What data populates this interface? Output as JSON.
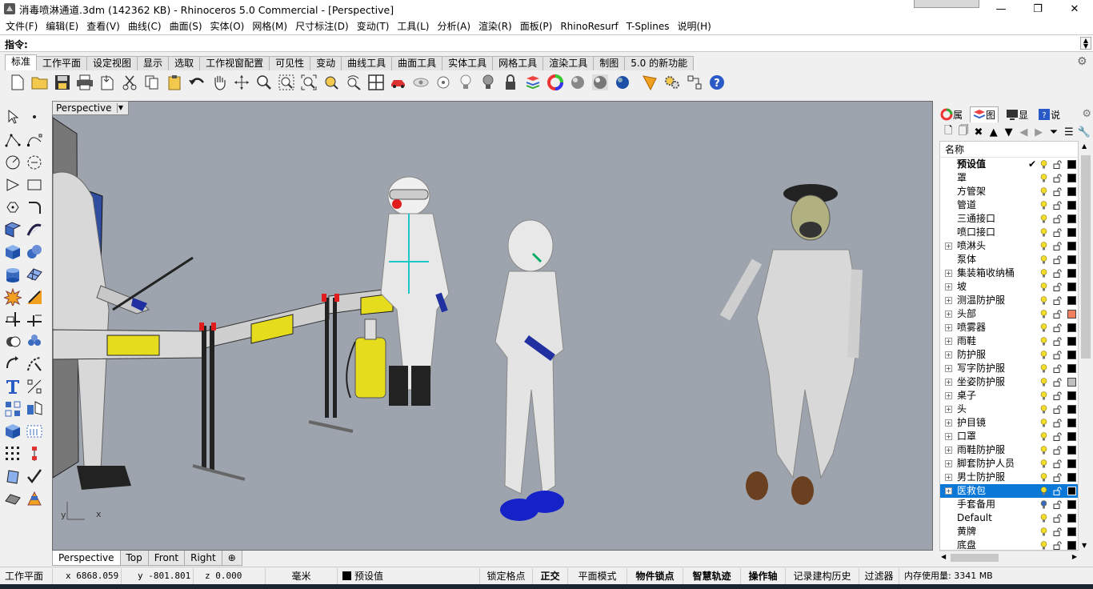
{
  "window": {
    "title": "消毒喷淋通道.3dm (142362 KB) - Rhinoceros 5.0 Commercial - [Perspective]",
    "minimize": "—",
    "maximize": "❐",
    "close": "✕"
  },
  "menu": [
    "文件(F)",
    "编辑(E)",
    "查看(V)",
    "曲线(C)",
    "曲面(S)",
    "实体(O)",
    "网格(M)",
    "尺寸标注(D)",
    "变动(T)",
    "工具(L)",
    "分析(A)",
    "渲染(R)",
    "面板(P)",
    "RhinoResurf",
    "T-Splines",
    "说明(H)"
  ],
  "command": {
    "label": "指令:",
    "value": ""
  },
  "toolbar_tabs": [
    "标准",
    "工作平面",
    "设定视图",
    "显示",
    "选取",
    "工作视窗配置",
    "可见性",
    "变动",
    "曲线工具",
    "曲面工具",
    "实体工具",
    "网格工具",
    "渲染工具",
    "制图",
    "5.0 的新功能"
  ],
  "toolbar_icons": [
    "new-icon",
    "open-icon",
    "save-icon",
    "print-icon",
    "import-icon",
    "cut-icon",
    "copy-icon",
    "paste-icon",
    "undo-icon",
    "pan-icon",
    "rotate-view-icon",
    "zoom-icon",
    "zoom-window-icon",
    "zoom-extents-icon",
    "zoom-selected-icon",
    "rotate-icon",
    "four-viewports-icon",
    "car-icon",
    "hide-icon",
    "show-icon",
    "light-off-icon",
    "light-on-icon",
    "lock-icon",
    "layer-icon",
    "color-wheel-icon",
    "sphere-shaded-icon",
    "sphere-rendered-icon",
    "sphere-blue-icon",
    "render-icon",
    "settings-icon",
    "options-icon",
    "help-icon"
  ],
  "viewport": {
    "name": "Perspective",
    "axis_y": "y",
    "axis_x": "x"
  },
  "viewport_tabs": [
    "Perspective",
    "Top",
    "Front",
    "Right"
  ],
  "viewport_tab_add": "⊕",
  "panel": {
    "tabs": [
      {
        "label": "属",
        "icon": "properties-icon"
      },
      {
        "label": "图",
        "icon": "layers-icon"
      },
      {
        "label": "显",
        "icon": "display-icon"
      },
      {
        "label": "说",
        "icon": "help-panel-icon"
      }
    ],
    "header": "名称",
    "layers": [
      {
        "name": "预设值",
        "bold": true,
        "check": "✔",
        "expand": false,
        "color": "#000000",
        "bulb": "yellow"
      },
      {
        "name": "罩",
        "expand": false,
        "color": "#000000",
        "bulb": "yellow"
      },
      {
        "name": "方管架",
        "expand": false,
        "color": "#000000",
        "bulb": "yellow"
      },
      {
        "name": "管道",
        "expand": false,
        "color": "#000000",
        "bulb": "yellow"
      },
      {
        "name": "三通接口",
        "expand": false,
        "color": "#000000",
        "bulb": "yellow"
      },
      {
        "name": "喷口接口",
        "expand": false,
        "color": "#000000",
        "bulb": "yellow"
      },
      {
        "name": "喷淋头",
        "expand": true,
        "color": "#000000",
        "bulb": "yellow"
      },
      {
        "name": "泵体",
        "expand": false,
        "color": "#000000",
        "bulb": "yellow"
      },
      {
        "name": "集装箱收纳桶",
        "expand": true,
        "color": "#000000",
        "bulb": "yellow"
      },
      {
        "name": "坡",
        "expand": true,
        "color": "#000000",
        "bulb": "yellow"
      },
      {
        "name": "测温防护服",
        "expand": true,
        "color": "#000000",
        "bulb": "yellow"
      },
      {
        "name": "头部",
        "expand": true,
        "color": "#f08060",
        "bulb": "yellow"
      },
      {
        "name": "喷雾器",
        "expand": true,
        "color": "#000000",
        "bulb": "yellow"
      },
      {
        "name": "雨鞋",
        "expand": true,
        "color": "#000000",
        "bulb": "yellow"
      },
      {
        "name": "防护服",
        "expand": true,
        "color": "#000000",
        "bulb": "yellow"
      },
      {
        "name": "写字防护服",
        "expand": true,
        "color": "#000000",
        "bulb": "yellow"
      },
      {
        "name": "坐姿防护服",
        "expand": true,
        "color": "#c0c0c0",
        "bulb": "yellow"
      },
      {
        "name": "桌子",
        "expand": true,
        "color": "#000000",
        "bulb": "yellow"
      },
      {
        "name": "头",
        "expand": true,
        "color": "#000000",
        "bulb": "yellow"
      },
      {
        "name": "护目镜",
        "expand": true,
        "color": "#000000",
        "bulb": "yellow"
      },
      {
        "name": "口罩",
        "expand": true,
        "color": "#000000",
        "bulb": "yellow"
      },
      {
        "name": "雨鞋防护服",
        "expand": true,
        "color": "#000000",
        "bulb": "yellow"
      },
      {
        "name": "脚套防护人员",
        "expand": true,
        "color": "#000000",
        "bulb": "yellow"
      },
      {
        "name": "男士防护服",
        "expand": true,
        "color": "#000000",
        "bulb": "yellow"
      },
      {
        "name": "医救包",
        "expand": true,
        "selected": true,
        "color": "#000000",
        "bulb": "yellow"
      },
      {
        "name": "手套备用",
        "expand": false,
        "color": "#000000",
        "bulb": "blue"
      },
      {
        "name": "Default",
        "expand": false,
        "color": "#000000",
        "bulb": "yellow"
      },
      {
        "name": "黄牌",
        "expand": false,
        "color": "#000000",
        "bulb": "yellow"
      },
      {
        "name": "底盘",
        "expand": false,
        "color": "#000000",
        "bulb": "yellow"
      }
    ]
  },
  "status": {
    "cplane": "工作平面",
    "x": "x 6868.059",
    "y": "y -801.801",
    "z": "z 0.000",
    "unit": "毫米",
    "layer": "预设值",
    "snap": "锁定格点",
    "ortho": "正交",
    "planar": "平面模式",
    "osnap": "物件锁点",
    "smarttrack": "智慧轨迹",
    "gumball": "操作轴",
    "history": "记录建构历史",
    "filter": "过滤器",
    "memory": "内存使用量: 3341 MB"
  },
  "colors": {
    "selection": "#0a78d7",
    "viewport_bg": "#9ea4ae"
  }
}
